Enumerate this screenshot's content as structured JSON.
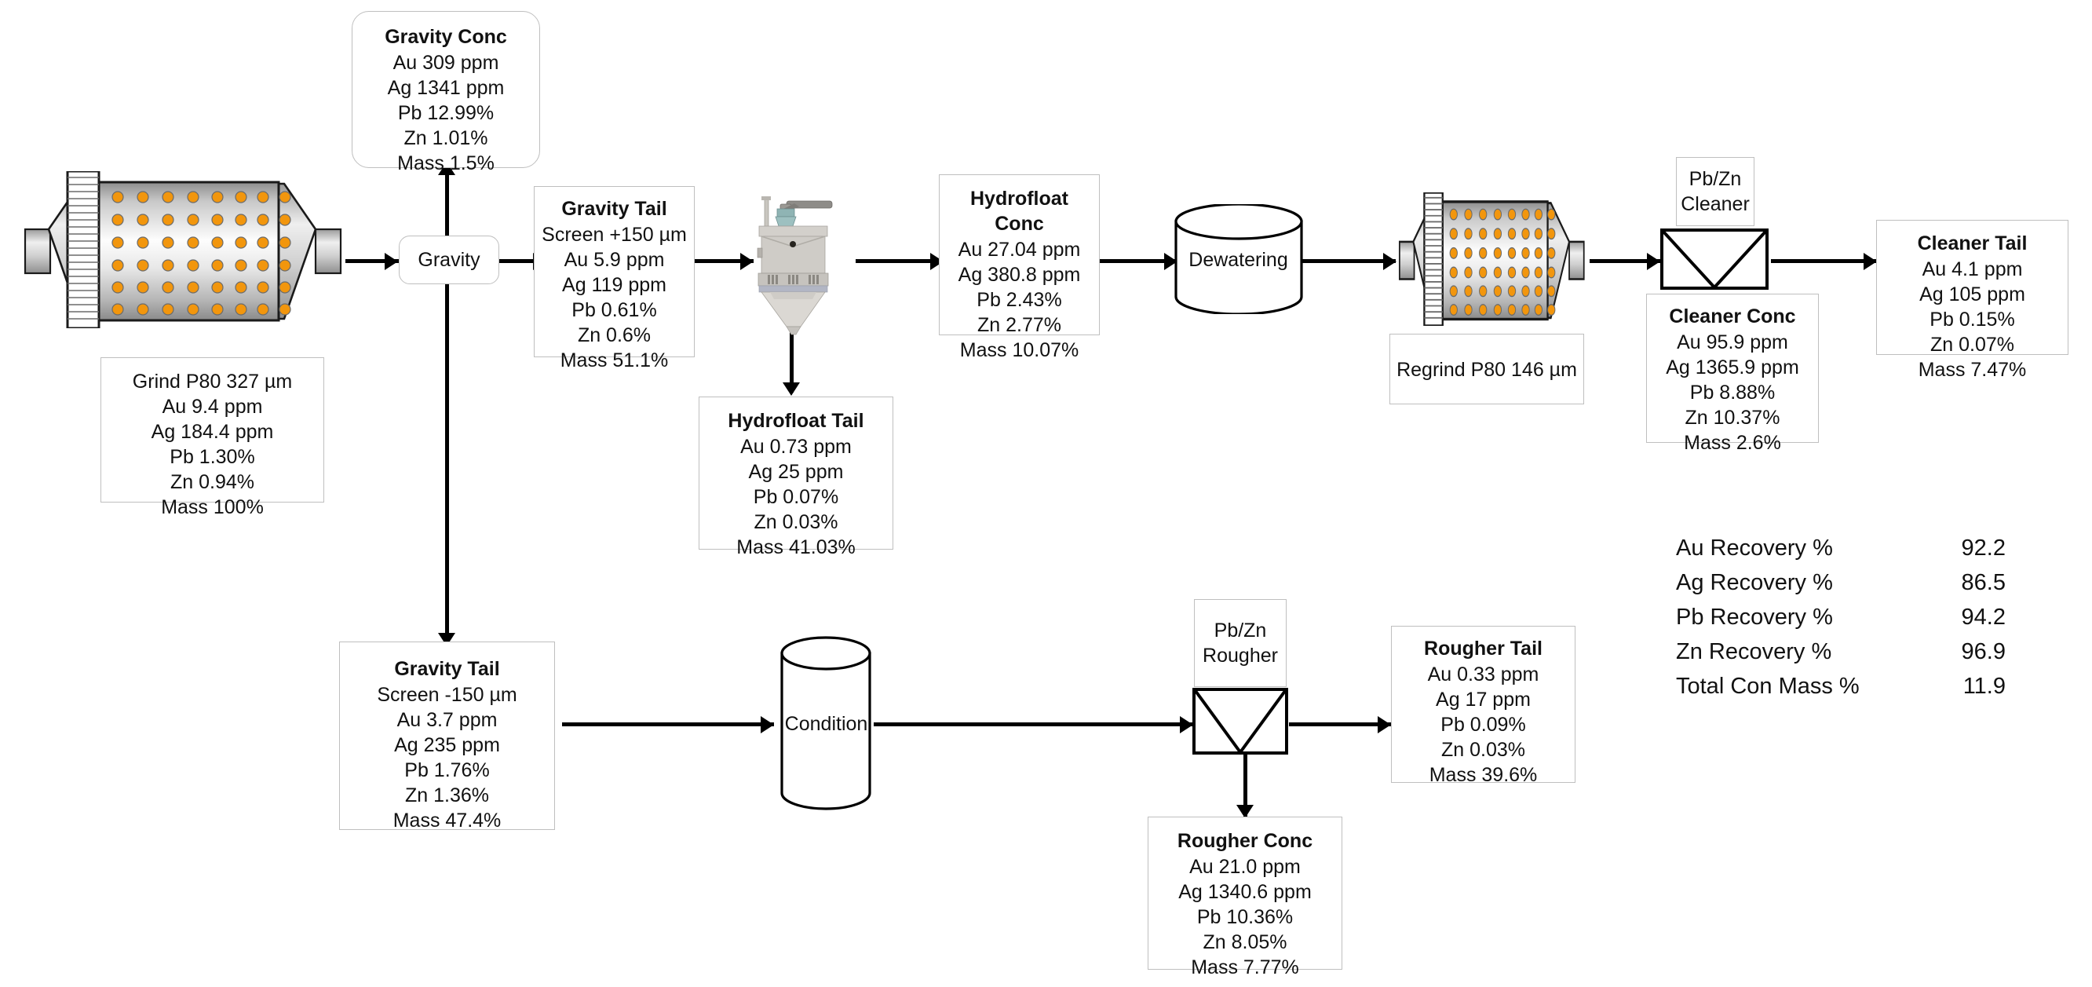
{
  "diagram": {
    "title": "Mineral Processing Flowsheet",
    "units": {
      "grind_mill": {
        "label": "grinding-mill"
      },
      "regrind_mill": {
        "label": "regrind-mill"
      },
      "gravity": {
        "label": "Gravity"
      },
      "dewatering": {
        "label": "Dewatering"
      },
      "condition": {
        "label": "Condition"
      },
      "pbzn_cleaner": {
        "line1": "Pb/Zn",
        "line2": "Cleaner"
      },
      "pbzn_rougher": {
        "line1": "Pb/Zn",
        "line2": "Rougher"
      },
      "hydrofloat": {
        "label": "hydrofloat-cell"
      }
    },
    "streams": {
      "grind_feed": {
        "title": "",
        "lines": [
          "Grind P80 327 µm",
          "Au 9.4 ppm",
          "Ag 184.4 ppm",
          "Pb 1.30%",
          "Zn 0.94%",
          "Mass 100%"
        ]
      },
      "gravity_conc": {
        "title": "Gravity Conc",
        "lines": [
          "Au 309 ppm",
          "Ag 1341 ppm",
          "Pb 12.99%",
          "Zn 1.01%",
          "Mass 1.5%"
        ]
      },
      "gravity_tail_plus150": {
        "title": "Gravity Tail",
        "lines": [
          "Screen +150 µm",
          "Au 5.9 ppm",
          "Ag 119 ppm",
          "Pb 0.61%",
          "Zn 0.6%",
          "Mass 51.1%"
        ]
      },
      "gravity_tail_minus150": {
        "title": "Gravity Tail",
        "lines": [
          "Screen -150 µm",
          "Au 3.7 ppm",
          "Ag 235 ppm",
          "Pb 1.76%",
          "Zn 1.36%",
          "Mass 47.4%"
        ]
      },
      "hydrofloat_conc": {
        "title": "Hydrofloat Conc",
        "lines": [
          "Au 27.04 ppm",
          "Ag 380.8 ppm",
          "Pb 2.43%",
          "Zn 2.77%",
          "Mass 10.07%"
        ]
      },
      "hydrofloat_tail": {
        "title": "Hydrofloat Tail",
        "lines": [
          "Au 0.73 ppm",
          "Ag 25 ppm",
          "Pb 0.07%",
          "Zn 0.03%",
          "Mass 41.03%"
        ]
      },
      "regrind": {
        "title": "",
        "lines": [
          "Regrind P80 146 µm"
        ]
      },
      "cleaner_conc": {
        "title": "Cleaner Conc",
        "lines": [
          "Au 95.9 ppm",
          "Ag 1365.9 ppm",
          "Pb 8.88%",
          "Zn 10.37%",
          "Mass 2.6%"
        ]
      },
      "cleaner_tail": {
        "title": "Cleaner Tail",
        "lines": [
          "Au 4.1 ppm",
          "Ag 105 ppm",
          "Pb 0.15%",
          "Zn 0.07%",
          "Mass 7.47%"
        ]
      },
      "rougher_conc": {
        "title": "Rougher Conc",
        "lines": [
          "Au 21.0 ppm",
          "Ag 1340.6 ppm",
          "Pb 10.36%",
          "Zn 8.05%",
          "Mass 7.77%"
        ]
      },
      "rougher_tail": {
        "title": "Rougher Tail",
        "lines": [
          "Au 0.33 ppm",
          "Ag 17 ppm",
          "Pb 0.09%",
          "Zn 0.03%",
          "Mass 39.6%"
        ]
      }
    },
    "recovery": {
      "rows": [
        {
          "label": "Au Recovery %",
          "value": "92.2"
        },
        {
          "label": "Ag Recovery %",
          "value": "86.5"
        },
        {
          "label": "Pb Recovery %",
          "value": "94.2"
        },
        {
          "label": "Zn Recovery %",
          "value": "96.9"
        },
        {
          "label": "Total Con Mass %",
          "value": "11.9"
        }
      ]
    },
    "colors": {
      "line": "#000000",
      "box_border": "#bfbfbf",
      "text": "#111111",
      "mill_ball": "#f2960d",
      "mill_body_light": "#fbfbfb",
      "mill_body_dark": "#8d8d8d"
    }
  }
}
